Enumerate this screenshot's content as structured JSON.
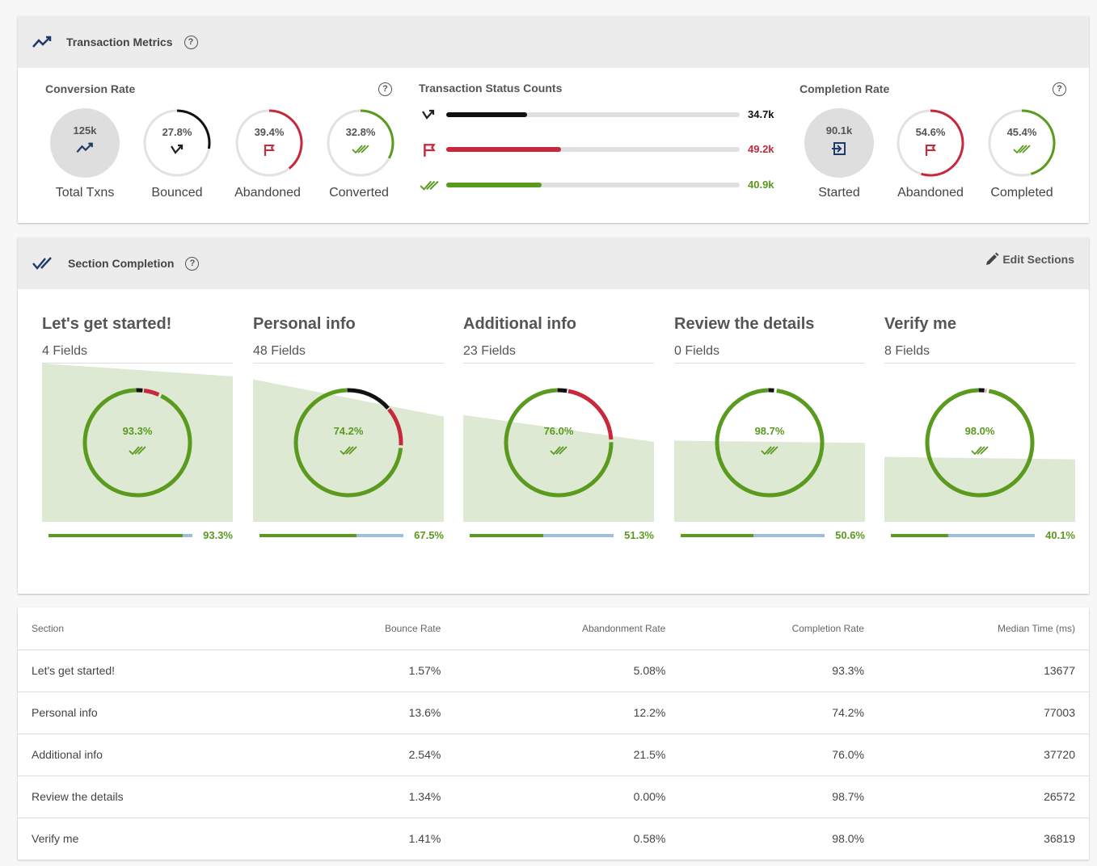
{
  "metrics": {
    "title": "Transaction Metrics",
    "conversion": {
      "label": "Conversion Rate",
      "total": {
        "value": "125k",
        "caption": "Total Txns"
      },
      "bounced": {
        "value": "27.8%",
        "caption": "Bounced",
        "percent": 27.8
      },
      "abandoned": {
        "value": "39.4%",
        "caption": "Abandoned",
        "percent": 39.4
      },
      "converted": {
        "value": "32.8%",
        "caption": "Converted",
        "percent": 32.8
      }
    },
    "status": {
      "label": "Transaction Status Counts",
      "bars": [
        {
          "value": "34.7k",
          "fraction": 0.276,
          "color": "#111111",
          "icon": "bounce-icon"
        },
        {
          "value": "49.2k",
          "fraction": 0.39,
          "color": "#c8283c",
          "icon": "flag-icon"
        },
        {
          "value": "40.9k",
          "fraction": 0.325,
          "color": "#5a9a1e",
          "icon": "double-check-icon"
        }
      ]
    },
    "completion": {
      "label": "Completion Rate",
      "started": {
        "value": "90.1k",
        "caption": "Started"
      },
      "abandoned": {
        "value": "54.6%",
        "caption": "Abandoned",
        "percent": 54.6
      },
      "completed": {
        "value": "45.4%",
        "caption": "Completed",
        "percent": 45.4
      }
    }
  },
  "sections": {
    "title": "Section Completion",
    "edit_label": "Edit Sections",
    "items": [
      {
        "title": "Let's get started!",
        "fields": "4 Fields",
        "ring": "93.3%",
        "ring_pct": 93.3,
        "abandon_pct": 5.08,
        "bounce_pct": 1.57,
        "funnel_start": 1.0,
        "funnel_end": 0.933,
        "bar_value": "93.3%",
        "bar_fraction": 0.933
      },
      {
        "title": "Personal info",
        "fields": "48 Fields",
        "ring": "74.2%",
        "ring_pct": 74.2,
        "abandon_pct": 12.2,
        "bounce_pct": 13.6,
        "funnel_start": 0.9,
        "funnel_end": 0.675,
        "bar_value": "67.5%",
        "bar_fraction": 0.675
      },
      {
        "title": "Additional info",
        "fields": "23 Fields",
        "ring": "76.0%",
        "ring_pct": 76.0,
        "abandon_pct": 21.5,
        "bounce_pct": 2.54,
        "funnel_start": 0.675,
        "funnel_end": 0.513,
        "bar_value": "51.3%",
        "bar_fraction": 0.513
      },
      {
        "title": "Review the details",
        "fields": "0 Fields",
        "ring": "98.7%",
        "ring_pct": 98.7,
        "abandon_pct": 0.0,
        "bounce_pct": 1.34,
        "funnel_start": 0.513,
        "funnel_end": 0.506,
        "bar_value": "50.6%",
        "bar_fraction": 0.506
      },
      {
        "title": "Verify me",
        "fields": "8 Fields",
        "ring": "98.0%",
        "ring_pct": 98.0,
        "abandon_pct": 0.58,
        "bounce_pct": 1.41,
        "funnel_start": 0.41,
        "funnel_end": 0.401,
        "bar_value": "40.1%",
        "bar_fraction": 0.401
      }
    ]
  },
  "table": {
    "headers": [
      "Section",
      "Bounce Rate",
      "Abandonment Rate",
      "Completion Rate",
      "Median Time (ms)"
    ],
    "rows": [
      [
        "Let's get started!",
        "1.57%",
        "5.08%",
        "93.3%",
        "13677"
      ],
      [
        "Personal info",
        "13.6%",
        "12.2%",
        "74.2%",
        "77003"
      ],
      [
        "Additional info",
        "2.54%",
        "21.5%",
        "76.0%",
        "37720"
      ],
      [
        "Review the details",
        "1.34%",
        "0.00%",
        "98.7%",
        "26572"
      ],
      [
        "Verify me",
        "1.41%",
        "0.58%",
        "98.0%",
        "36819"
      ]
    ]
  },
  "colors": {
    "green": "#5a9a1e",
    "red": "#c8283c",
    "black": "#111111",
    "navy": "#1f3a68",
    "funnel": "#dde9d3",
    "blue_bar": "#9cbddc"
  }
}
